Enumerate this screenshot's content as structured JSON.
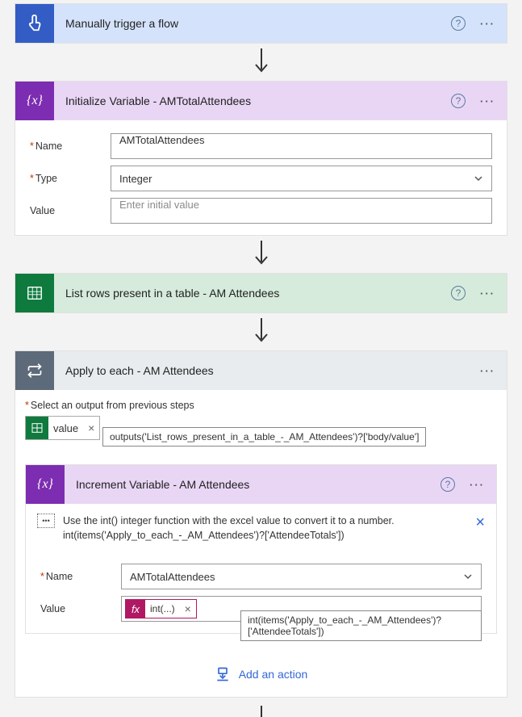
{
  "trigger": {
    "title": "Manually trigger a flow"
  },
  "initVar": {
    "title": "Initialize Variable - AMTotalAttendees",
    "nameLabel": "Name",
    "nameValue": "AMTotalAttendees",
    "typeLabel": "Type",
    "typeValue": "Integer",
    "valueLabel": "Value",
    "valuePlaceholder": "Enter initial value"
  },
  "listRows": {
    "title": "List rows present in a table - AM Attendees"
  },
  "applyEach": {
    "title": "Apply to each - AM Attendees",
    "selectLabel": "Select an output from previous steps",
    "token": "value",
    "tokenTooltip": "outputs('List_rows_present_in_a_table_-_AM_Attendees')?['body/value']"
  },
  "increment": {
    "title": "Increment Variable - AM Attendees",
    "noteLine1": "Use the int() integer function with the excel value to convert it to a number.",
    "noteLine2": "int(items('Apply_to_each_-_AM_Attendees')?['AttendeeTotals'])",
    "nameLabel": "Name",
    "nameValue": "AMTotalAttendees",
    "valueLabel": "Value",
    "fxLabel": "int(...)",
    "fxTooltip": "int(items('Apply_to_each_-_AM_Attendees')?['AttendeeTotals'])"
  },
  "addAction": "Add an action",
  "icons": {
    "fx": "fx"
  }
}
